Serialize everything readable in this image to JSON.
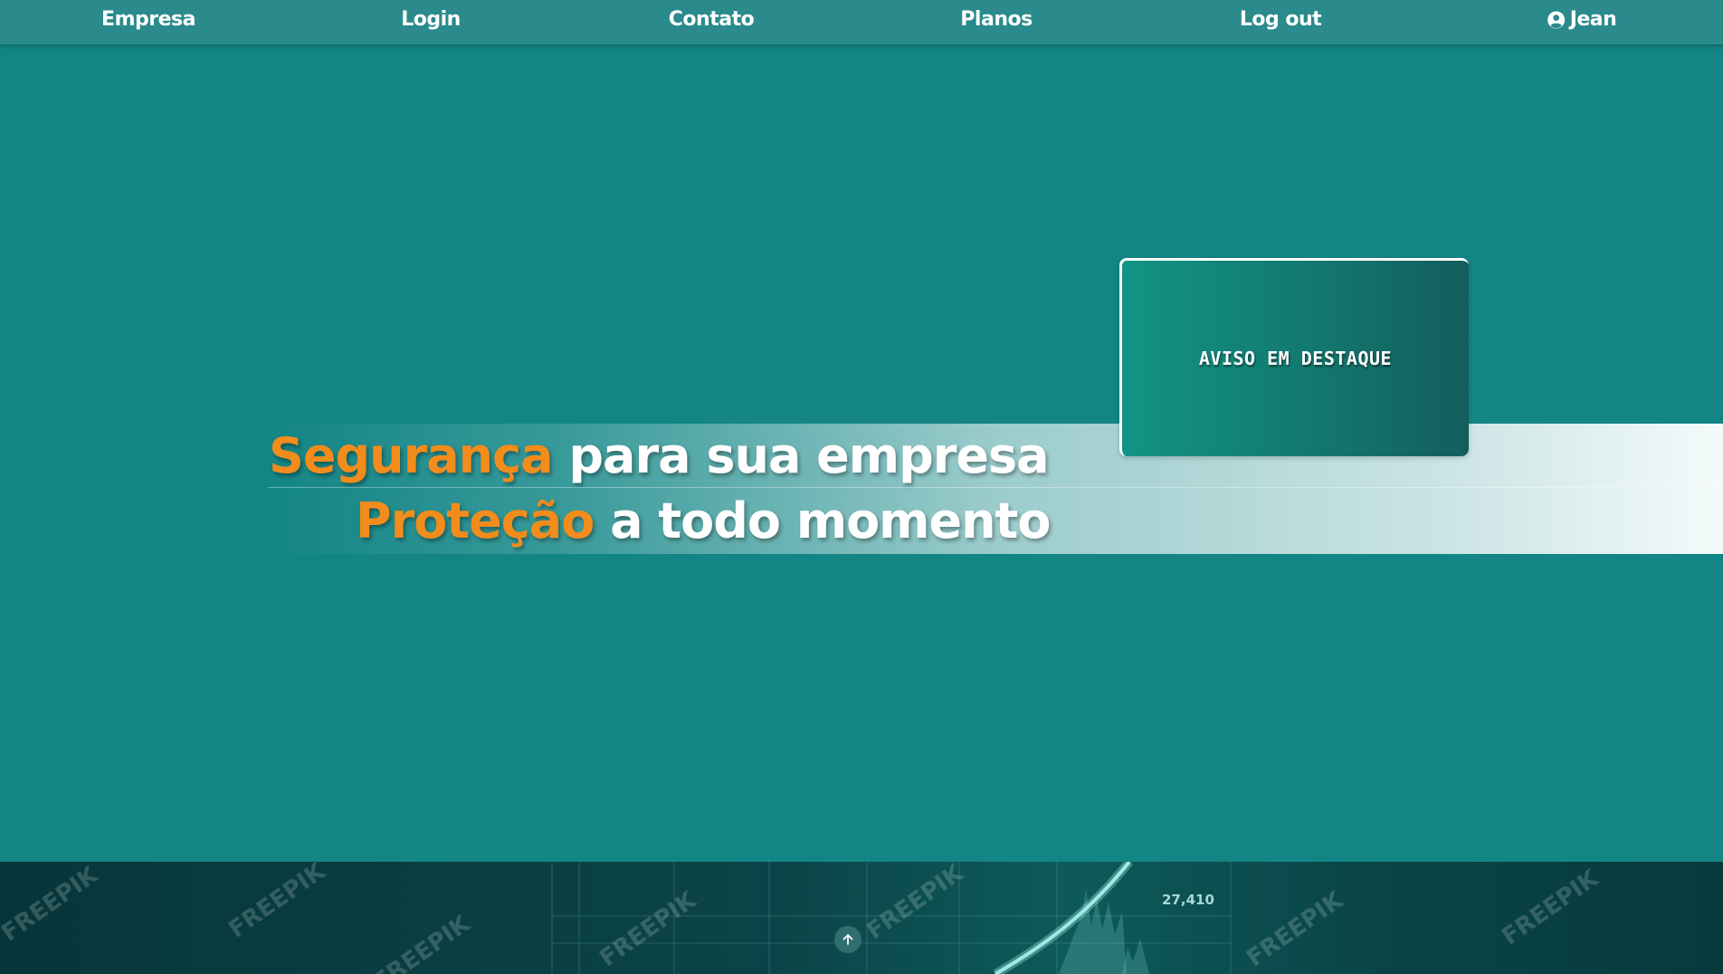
{
  "navbar": {
    "items": [
      {
        "label": "Empresa"
      },
      {
        "label": "Login"
      },
      {
        "label": "Contato"
      },
      {
        "label": "Planos"
      },
      {
        "label": "Log out"
      }
    ],
    "user": {
      "label": "Jean",
      "icon": "user-circle-icon"
    }
  },
  "hero": {
    "line1": {
      "accent": "Segurança",
      "rest": "para sua empresa"
    },
    "line2": {
      "accent": "Proteção",
      "rest": "a todo momento"
    }
  },
  "notice": {
    "title": "AVISO EM DESTAQUE"
  },
  "footer": {
    "ticker_value": "27,410",
    "watermark": "FREEPIK",
    "scroll_top_icon": "arrow-up-icon"
  },
  "colors": {
    "background": "#138585",
    "navbar": "#2a8a8c",
    "accent": "#f28c1c",
    "text": "#ffffff"
  }
}
